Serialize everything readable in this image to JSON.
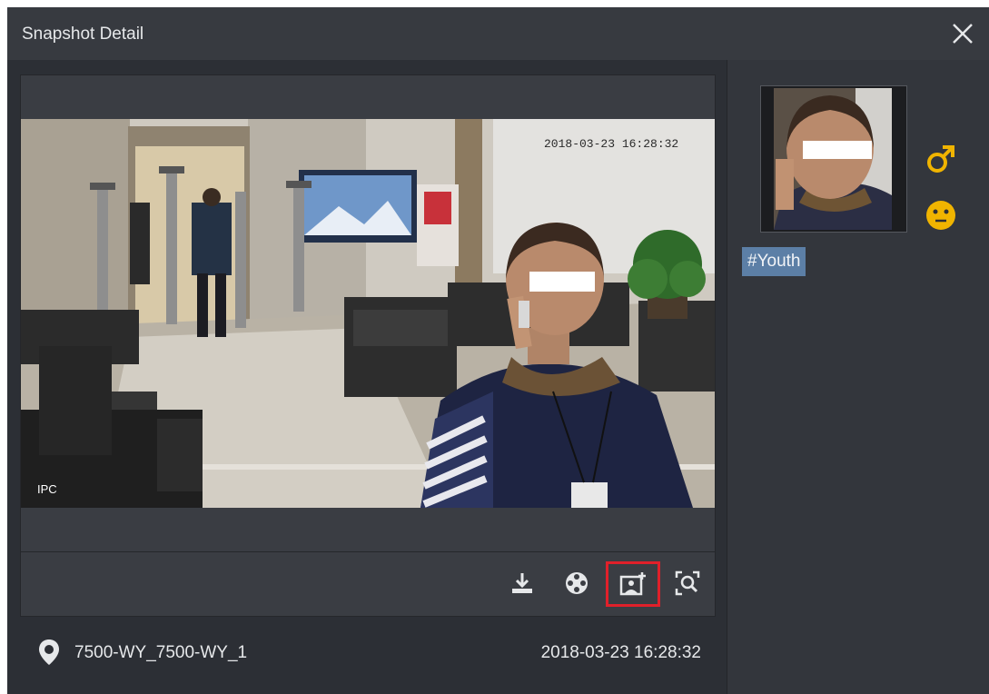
{
  "dialog": {
    "title": "Snapshot Detail"
  },
  "snapshot": {
    "overlay_label": "IPC",
    "watermark_text": "2018-03-23 16:28:32"
  },
  "toolbar": {
    "items": [
      {
        "name": "download",
        "icon": "download-icon"
      },
      {
        "name": "play-video",
        "icon": "film-reel-icon"
      },
      {
        "name": "add-to-face-library",
        "icon": "image-add-icon",
        "selected": true
      },
      {
        "name": "search-by-image",
        "icon": "image-search-icon"
      }
    ],
    "highlight_color": "#e0202a"
  },
  "meta": {
    "location": "7500-WY_7500-WY_1",
    "timestamp": "2018-03-23 16:28:32"
  },
  "face": {
    "attributes": [
      {
        "name": "gender",
        "icon": "male-icon",
        "color": "#f0b400"
      },
      {
        "name": "expression",
        "icon": "neutral-face-icon",
        "color": "#f0b400"
      }
    ],
    "tag": "#Youth"
  },
  "colors": {
    "background": "#2c2f35",
    "titlebar": "#373a40",
    "accent_yellow": "#f0b400",
    "tag_bg": "#5c7fa6"
  }
}
